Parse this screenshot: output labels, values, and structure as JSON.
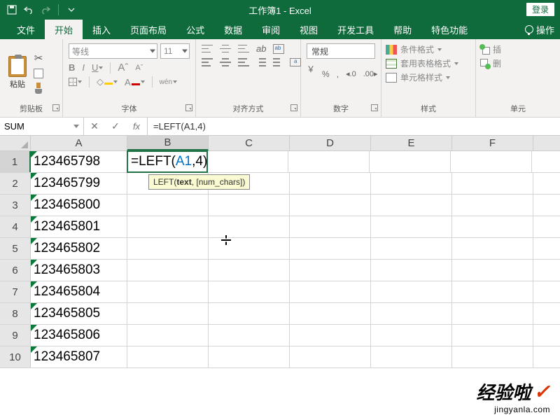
{
  "title": "工作簿1 - Excel",
  "login": "登录",
  "tabs": [
    "文件",
    "开始",
    "插入",
    "页面布局",
    "公式",
    "数据",
    "审阅",
    "视图",
    "开发工具",
    "帮助",
    "特色功能"
  ],
  "active_tab": 1,
  "tell_me": "操作",
  "ribbon": {
    "clipboard": {
      "label": "剪贴板",
      "paste": "粘贴"
    },
    "font": {
      "label": "字体",
      "name_placeholder": "等线",
      "size_placeholder": "11",
      "buttons": {
        "bold": "B",
        "italic": "I",
        "underline": "U",
        "grow": "A",
        "shrink": "A",
        "phonetic": "wén",
        "fontcolor": "A"
      }
    },
    "align": {
      "label": "对齐方式"
    },
    "number": {
      "label": "数字",
      "format": "常规",
      "percent": "%",
      "comma": ",",
      "currency": "￥"
    },
    "styles": {
      "label": "样式",
      "cond": "条件格式",
      "table": "套用表格格式",
      "cell": "单元格样式"
    },
    "cells": {
      "label": "单元",
      "insert": "插",
      "delete": "删"
    }
  },
  "namebox": "SUM",
  "formula": "=LEFT(A1,4)",
  "tooltip": {
    "fn": "LEFT",
    "arg1": "text",
    "arg2": "[num_chars]"
  },
  "columns": [
    "A",
    "B",
    "C",
    "D",
    "E",
    "F"
  ],
  "cell_formula": {
    "prefix": "=LEFT(",
    "ref": "A1",
    "suffix": ",4)"
  },
  "rows": [
    {
      "n": 1,
      "a": "123465798"
    },
    {
      "n": 2,
      "a": "123465799"
    },
    {
      "n": 3,
      "a": "123465800"
    },
    {
      "n": 4,
      "a": "123465801"
    },
    {
      "n": 5,
      "a": "123465802"
    },
    {
      "n": 6,
      "a": "123465803"
    },
    {
      "n": 7,
      "a": "123465804"
    },
    {
      "n": 8,
      "a": "123465805"
    },
    {
      "n": 9,
      "a": "123465806"
    },
    {
      "n": 10,
      "a": "123465807"
    }
  ],
  "watermark": {
    "main": "经验啦",
    "sub": "jingyanla.com"
  }
}
